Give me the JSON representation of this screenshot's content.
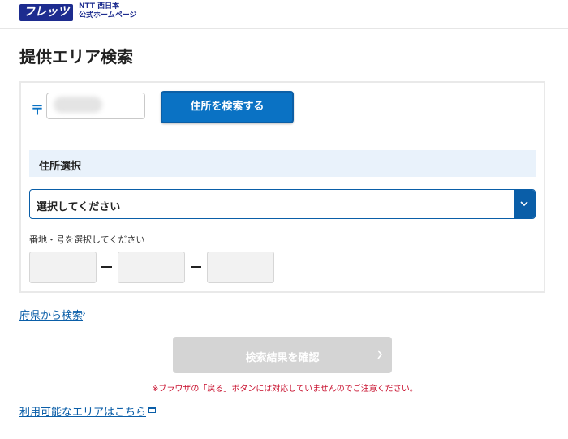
{
  "header": {
    "logo_text": "フレッツ",
    "brand_line1": "NTT 西日本",
    "brand_line2": "公式ホームページ"
  },
  "page": {
    "title": "提供エリア検索"
  },
  "postal": {
    "mark": "〒",
    "zip_value": "",
    "search_button": "住所を検索する"
  },
  "address": {
    "section_label": "住所選択",
    "select_value": "選択してください",
    "banchi_label": "番地・号を選択してください"
  },
  "links": {
    "prefecture": "府県から検索",
    "available_area": "利用可能なエリアはこちら"
  },
  "confirm": {
    "button_label": "検索結果を確認"
  },
  "notice": {
    "text": "※ブラウザの「戻る」ボタンには対応していませんのでご注意ください。"
  },
  "colors": {
    "primary": "#0a72c4",
    "brand": "#1d2c8f",
    "warning": "#c8102e",
    "section_bg": "#e9f2fb"
  }
}
